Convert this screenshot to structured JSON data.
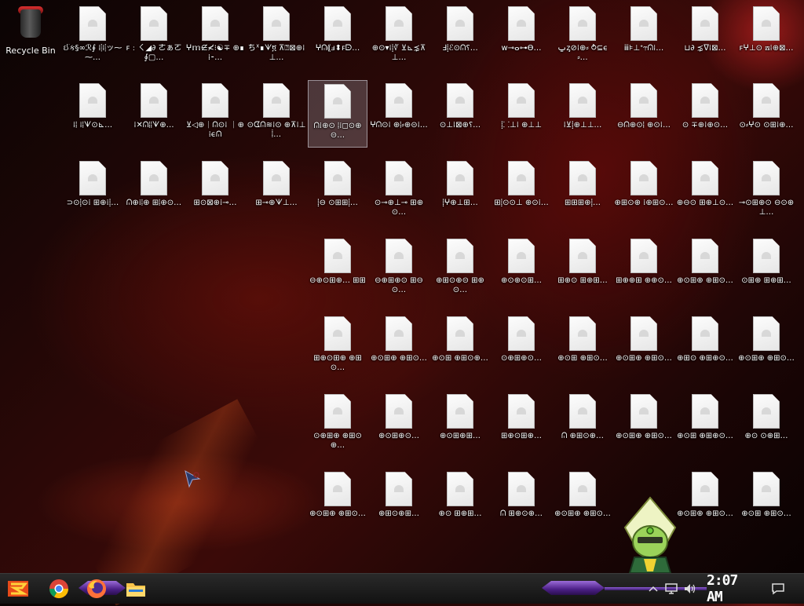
{
  "desktop": {
    "recycle_bin_label": "Recycle Bin",
    "icons": [
      [
        "ઈક§∞ℛ∮ ⁞⸽⁞⸽ッ⁓⁓…",
        "ꜰ﹕ㄑ◢∂ ㄜぁㄛ∮▢…",
        "ⵖ𝕞∉≮⁝☯∓ ⊕∎⁞⁃…",
        "ちᕁ∎ᗐ፬ ⊼⍰⊠⊕⁞⊥…",
        "ⵖᕬ⸨ⅎ⬍ꜰᗠ…",
        "⊕⊙▾⁞⸽∛ ⊻⊾⋨⊼⊥…",
        "Ⅎ⸽ℰ⊙ᕬ⸮…",
        "ᴡ⊸ⴰ⊶ϴ…",
        "ݐᶎ⊘⁞⊕⸗ ⥁⊆ϵ⸗…",
        "ⅲ⊧⊥ᐩ⥾ᕬ⁞…",
        "⊔∂ ⋨ᐁ⁞⊠…",
        "ꜰⵖ⊥⊙ ⟎⁞⊕⊠…"
      ],
      [
        "⁞⸽ ⁞⸽ᗐ⊙⊾…",
        "⁞✕ᕬ⸽⸽ᗐ⊕…",
        "⊻◁⊕⎾ᕬ⊙⁞ ⎾⊕⁞ϵᕬ",
        "⊙ᗧᕬ≋⁞⊙ ⊕⊼⁞⊥⸽…",
        "ᕬ⁞⊕⊙ ⸽⁞◻⊙⊕⊝…",
        "ⵖᕬ⊙⁞ ⊕⸽⸗⊕⊝⁞…",
        "⊙⊥⁞⊠⊕⸮…",
        "⸽⸬⊥⁞ ⊕⊥⊥",
        "⁞⊻⸽⊕⊥⊥…",
        "⊖ᕬ⊕⊙⸽ ⊕⊙⁞…",
        "⊙ ∓⊕⁞⊕⊙…",
        "⊙⸗ⵖ⊙ ⊙⊞⁞⊕…"
      ],
      [
        "⊃⊙⸽⊙⁞ ⊞⊕⁞⸽…",
        "ᕬ⊕⁞⸽⊕ ⊞⸽⊕⊙…",
        "⊞⊙⊠⊕⁞⊸…",
        "⊞⊸⊕ᗐ⊥…",
        "⸽⊖ ⊙⊞⊞⸽…",
        "⊙⊸⊕⊥⊸ ⊞⊕⊙…",
        "⸽ⵖ⊕⊥⊞…",
        "⊞⸽⊙⊙⊥ ⊕⊙⁞…",
        "⊞⊞⊞⊕⸽…",
        "⊕⊞⊙⊕ ⁞⊕⊞⊙…",
        "⊕⊖⊙ ⊞⊕⊥⊙…",
        "⊸⊙⊞⊕⊙ ⊖⊙⊕⊥…"
      ],
      [
        "⊖⊕⊙⊞⊕… ⊞⊞",
        "⊖⊕⊞⊕⊙ ⊞⊖⊙…",
        "⊕⊞⊙⊕⊝ ⊞⊕⊙…",
        "⊕⊙⊕⊙⊞…",
        "⊞⊕⊙ ⊞⊕⊞…",
        "⊞⊕⊕⊞ ⊕⊕⊙…",
        "⊕⊙⊞⊕ ⊕⊞⊙…",
        "⊙⊞⊕ ⊞⊕⊞…"
      ],
      [
        "⊞⊕⊙⊞⊕ ⊕⊞⊙…",
        "⊕⊙⊞⊕ ⊕⊞⊙…",
        "⊕⊙⊞ ⊕⊞⊙⊕…",
        "⊙⊕⊞⊕⊙…",
        "⊕⊙⊞ ⊕⊞⊙…",
        "⊕⊙⊞⊕ ⊕⊞⊙…",
        "⊕⊞⊙ ⊕⊞⊕⊙…",
        "⊕⊙⊞⊕ ⊕⊞⊙…"
      ],
      [
        "⊙⊕⊞⊕ ⊕⊞⊙⊕…",
        "⊕⊙⊞⊕⊙…",
        "⊕⊙⊞⊕⊞…",
        "⊞⊕⊙⊞⊕…",
        "ᕬ ⊕⊞⊙⊕…",
        "⊕⊙⊞⊕ ⊕⊞⊙…",
        "⊕⊙⊞ ⊕⊞⊕⊙…",
        "⊕⊙ ⊙⊕⊞…"
      ],
      [
        "⊕⊙⊞⊕ ⊕⊞⊙…",
        "⊕⊞⊙⊕⊞…",
        "⊕⊙ ⊞⊕⊞…",
        "ᕬ ⊞⊕⊙⊕…",
        "⊕⊙⊞⊕ ⊕⊞⊙…",
        "",
        "⊕⊙⊞⊕ ⊕⊞⊙…",
        "⊕⊙⊞ ⊕⊞⊙…"
      ]
    ]
  },
  "taskbar": {
    "clock": "2:07 AM",
    "icons": [
      "start-logo-icon",
      "chrome-icon",
      "firefox-icon",
      "file-explorer-icon"
    ],
    "tray": [
      "chevron-up-icon",
      "network-icon",
      "volume-icon",
      "notification-icon"
    ],
    "accent": "#6b3fb0"
  }
}
